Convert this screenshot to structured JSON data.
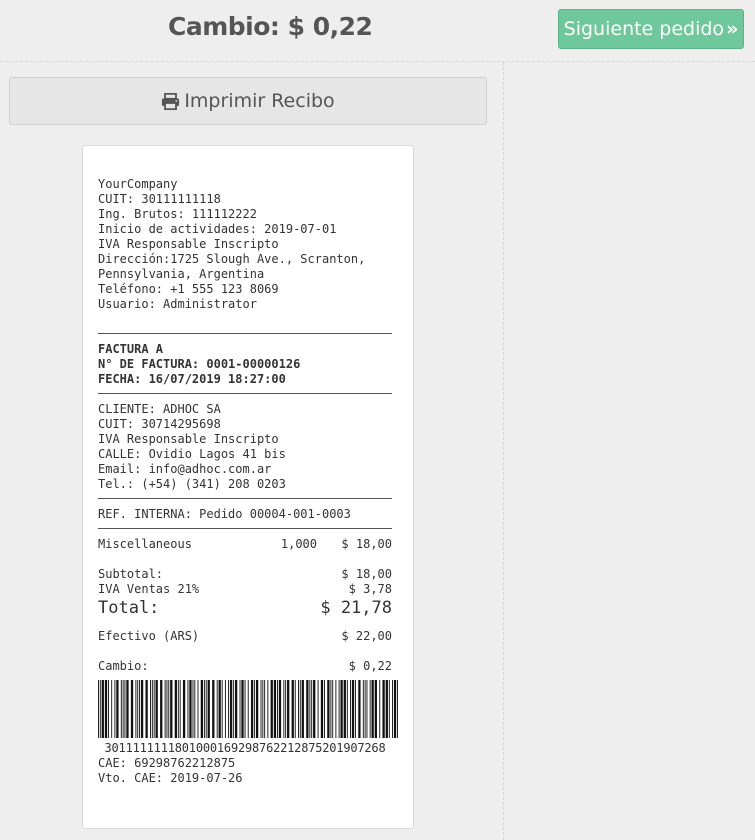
{
  "header": {
    "change_label": "Cambio: $ 0,22",
    "next_button": "Siguiente pedido"
  },
  "print_button": "Imprimir Recibo",
  "receipt": {
    "company": {
      "lines": [
        "YourCompany",
        "CUIT: 30111111118",
        "Ing. Brutos: 111112222",
        "Inicio de actividades: 2019-07-01",
        "IVA Responsable Inscripto",
        "Dirección:1725 Slough Ave., Scranton,",
        "Pennsylvania, Argentina",
        "Teléfono: +1 555 123 8069",
        "Usuario: Administrator"
      ]
    },
    "invoice": {
      "lines": [
        "FACTURA A",
        "N° DE FACTURA: 0001-00000126",
        "FECHA: 16/07/2019 18:27:00"
      ]
    },
    "client": {
      "lines": [
        "CLIENTE: ADHOC SA",
        "CUIT: 30714295698",
        "IVA Responsable Inscripto",
        "CALLE: Ovidio Lagos 41 bis",
        "Email: info@adhoc.com.ar",
        "Tel.: (+54) (341) 208 0203"
      ]
    },
    "reference": "REF. INTERNA: Pedido 00004-001-0003",
    "items": [
      {
        "name": "Miscellaneous",
        "qty": "1,000",
        "amount": "$ 18,00"
      }
    ],
    "subtotal_label": "Subtotal:",
    "subtotal_value": "$ 18,00",
    "tax_label": "IVA Ventas 21%",
    "tax_value": "$ 3,78",
    "total_label": "Total:",
    "total_value": "$ 21,78",
    "payment_label": "Efectivo (ARS)",
    "payment_value": "$ 22,00",
    "change_label": "Cambio:",
    "change_value": "$ 0,22",
    "barcode_number": "30111111118010001692987622128752019072​68",
    "cae": "CAE: 69298762212875",
    "cae_due": "Vto. CAE: 2019-07-26"
  }
}
